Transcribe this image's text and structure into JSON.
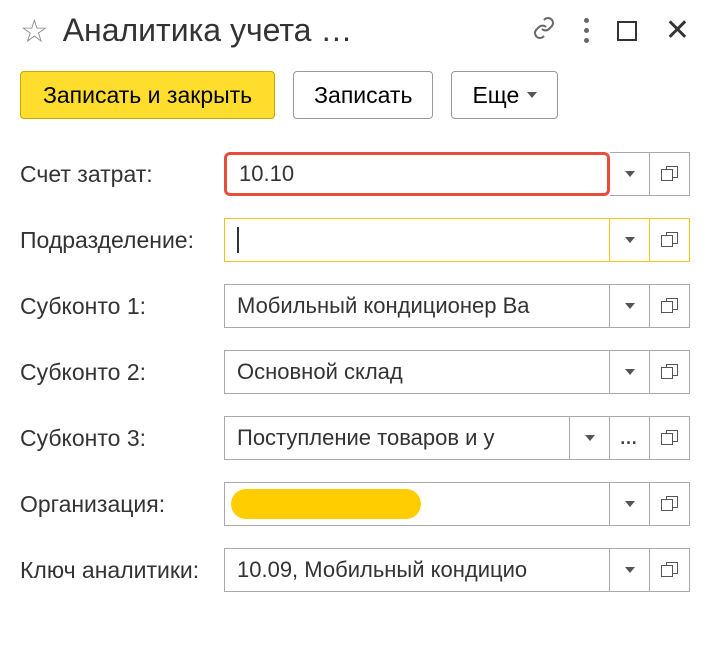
{
  "titlebar": {
    "title": "Аналитика учета …"
  },
  "toolbar": {
    "save_close": "Записать и закрыть",
    "save": "Записать",
    "more": "Еще"
  },
  "rows": {
    "account": {
      "label": "Счет затрат:",
      "value": "10.10"
    },
    "department": {
      "label": "Подразделение:",
      "value": ""
    },
    "sub1": {
      "label": "Субконто 1:",
      "value": "Мобильный кондиционер Ва"
    },
    "sub2": {
      "label": "Субконто 2:",
      "value": "Основной склад"
    },
    "sub3": {
      "label": "Субконто 3:",
      "value": "Поступление товаров и у"
    },
    "org": {
      "label": "Организация:",
      "value": ""
    },
    "key": {
      "label": "Ключ аналитики:",
      "value": "10.09, Мобильный кондицио"
    }
  }
}
